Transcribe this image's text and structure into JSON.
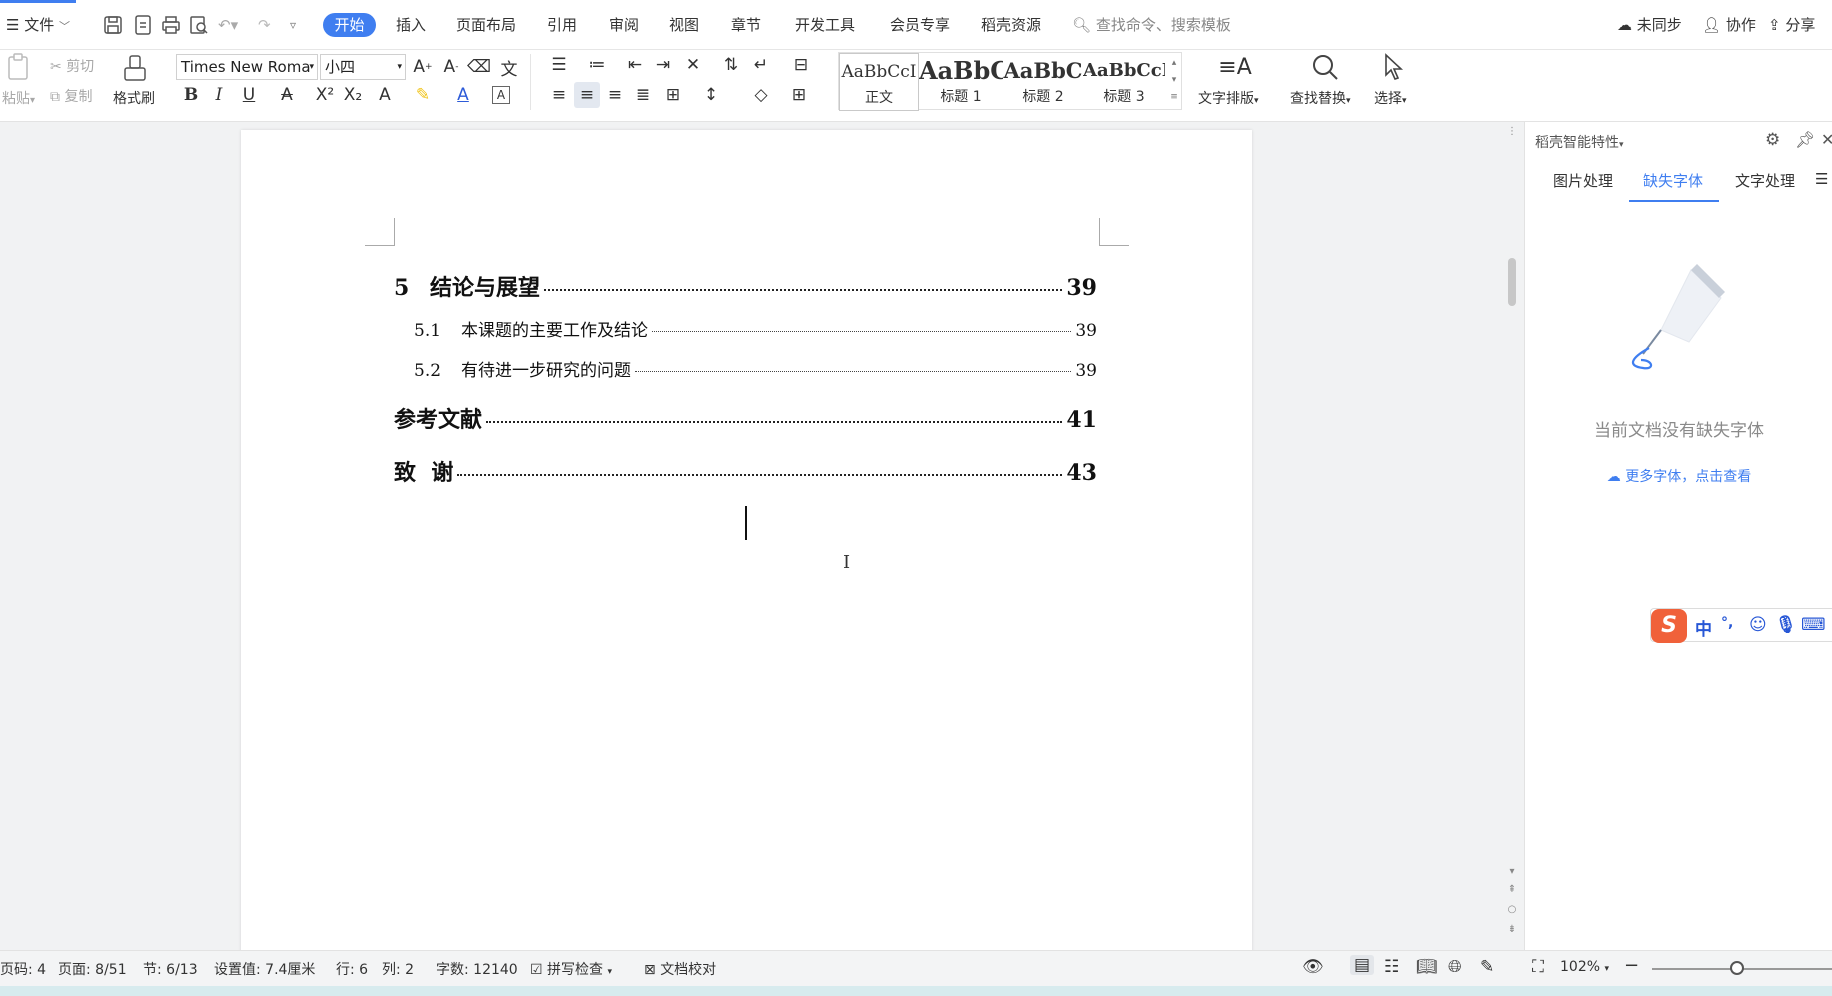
{
  "menubar": {
    "file_label": "文件",
    "tabs": [
      {
        "label": "开始",
        "active": true
      },
      {
        "label": "插入"
      },
      {
        "label": "页面布局"
      },
      {
        "label": "引用"
      },
      {
        "label": "审阅"
      },
      {
        "label": "视图"
      },
      {
        "label": "章节"
      },
      {
        "label": "开发工具"
      },
      {
        "label": "会员专享"
      },
      {
        "label": "稻壳资源"
      }
    ],
    "search_placeholder": "查找命令、搜索模板",
    "right": {
      "sync_label": "未同步",
      "collab_label": "协作",
      "share_label": "分享"
    },
    "accent_color": "#3f7ef0"
  },
  "ribbon": {
    "paste_label": "粘贴",
    "cut_label": "剪切",
    "copy_label": "复制",
    "format_painter_label": "格式刷",
    "font_name": "Times New Roma",
    "font_size": "小四",
    "styles": [
      {
        "preview": "AaBbCcI",
        "label": "正文"
      },
      {
        "preview": "AaBbC",
        "label": "标题 1"
      },
      {
        "preview": "AaBbC",
        "label": "标题 2"
      },
      {
        "preview": "AaBbCcI",
        "label": "标题 3"
      }
    ],
    "text_layout_label": "文字排版",
    "find_replace_label": "查找替换",
    "select_label": "选择"
  },
  "document": {
    "toc": [
      {
        "num": "5",
        "title": "结论与展望",
        "page": "39",
        "level": 1
      },
      {
        "num": "5.1",
        "title": "本课题的主要工作及结论",
        "page": "39",
        "level": 2
      },
      {
        "num": "5.2",
        "title": "有待进一步研究的问题",
        "page": "39",
        "level": 2
      },
      {
        "num": "",
        "title": "参考文献",
        "page": "41",
        "level": 1
      },
      {
        "num": "",
        "title": "致  谢",
        "page": "43",
        "level": 1
      }
    ]
  },
  "side_panel": {
    "title": "稻壳智能特性",
    "tabs": [
      {
        "label": "图片处理"
      },
      {
        "label": "缺失字体",
        "active": true
      },
      {
        "label": "文字处理"
      }
    ],
    "message": "当前文档没有缺失字体",
    "link": "更多字体，点击查看"
  },
  "ime": {
    "items": [
      "中",
      "°,"
    ]
  },
  "statusbar": {
    "page_code": "页码: 4",
    "page": "页面: 8/51",
    "section": "节: 6/13",
    "setting": "设置值: 7.4厘米",
    "row": "行: 6",
    "col": "列: 2",
    "word_count": "字数: 12140",
    "spell_check": "拼写检查",
    "doc_proof": "文档校对",
    "zoom": "102%",
    "zoom_level": 0.55
  }
}
